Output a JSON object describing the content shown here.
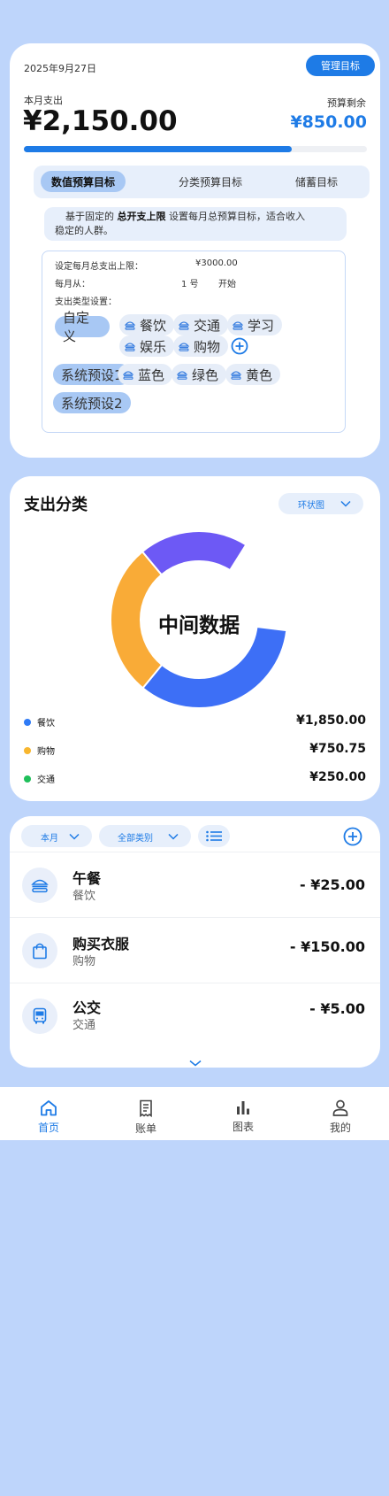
{
  "budget": {
    "date": "2025年9月27日",
    "manage_button": "管理目标",
    "spent_label": "本月支出",
    "spent_value": "¥2,150.00",
    "remaining_label": "预算剩余",
    "remaining_value": "¥850.00",
    "progress_fraction": 0.78,
    "tabs": [
      "数值预算目标",
      "分类预算目标",
      "储蓄目标"
    ],
    "active_tab": 0,
    "description_prefix": "基于固定的",
    "description_bold": "总开支上限",
    "description_suffix_1": "设置每月总预算目标，适合收入",
    "description_suffix_2": "稳定的人群。",
    "form": {
      "limit_label": "设定每月总支出上限：",
      "limit_value": "¥3000.00",
      "start_label": "每月从：",
      "start_day": "1 号",
      "start_word": "开始",
      "types_label": "支出类型设置：",
      "custom_button": "自定义",
      "custom_chips": [
        "餐饮",
        "交通",
        "学习",
        "娱乐",
        "购物"
      ],
      "preset1_button": "系统预设1",
      "preset1_chips": [
        "蓝色",
        "绿色",
        "黄色"
      ],
      "preset2_button": "系统预设2"
    }
  },
  "expense_category": {
    "title": "支出分类",
    "chart_type_selector": "环状图",
    "center_label": "中间数据",
    "legend": [
      {
        "name": "餐饮",
        "amount": "¥1,850.00",
        "color": "#2f7bf6"
      },
      {
        "name": "购物",
        "amount": "¥750.75",
        "color": "#f8b62e"
      },
      {
        "name": "交通",
        "amount": "¥250.00",
        "color": "#1fbf5a"
      }
    ]
  },
  "chart_data": {
    "type": "pie",
    "title": "",
    "categories": [
      "blue",
      "orange",
      "purple"
    ],
    "values": [
      34,
      28,
      20
    ],
    "gap_fraction": 0.18,
    "colors": [
      "#3d6ff6",
      "#f9ab37",
      "#6d59f5"
    ]
  },
  "transactions": {
    "filter_month": "本月",
    "filter_category": "全部类别",
    "items": [
      {
        "title": "午餐",
        "category": "餐饮",
        "amount": "- ¥25.00",
        "icon": "burger-icon"
      },
      {
        "title": "购买衣服",
        "category": "购物",
        "amount": "- ¥150.00",
        "icon": "shopping-bag-icon"
      },
      {
        "title": "公交",
        "category": "交通",
        "amount": "- ¥5.00",
        "icon": "bus-icon"
      }
    ]
  },
  "nav": {
    "items": [
      {
        "label": "首页",
        "icon": "home-icon",
        "active": true
      },
      {
        "label": "账单",
        "icon": "receipt-icon",
        "active": false
      },
      {
        "label": "图表",
        "icon": "bar-chart-icon",
        "active": false
      },
      {
        "label": "我的",
        "icon": "user-icon",
        "active": false
      }
    ],
    "active_color": "#1e7be6"
  },
  "colors": {
    "accent": "#1e7be6",
    "background": "#bed5fb"
  }
}
